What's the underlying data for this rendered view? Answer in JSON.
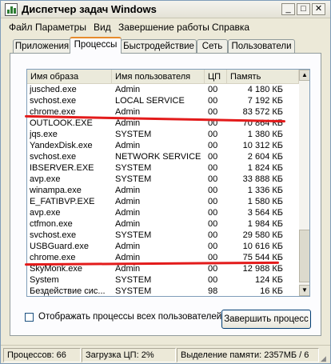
{
  "window": {
    "title": "Диспетчер задач Windows"
  },
  "menu": [
    "Файл",
    "Параметры",
    "Вид",
    "Завершение работы",
    "Справка"
  ],
  "tabs": [
    "Приложения",
    "Процессы",
    "Быстродействие",
    "Сеть",
    "Пользователи"
  ],
  "active_tab": "Процессы",
  "columns": [
    "Имя образа",
    "Имя пользователя",
    "ЦП",
    "Память"
  ],
  "processes": [
    {
      "name": "jusched.exe",
      "user": "Admin",
      "cpu": "00",
      "mem": "4 180 КБ"
    },
    {
      "name": "svchost.exe",
      "user": "LOCAL SERVICE",
      "cpu": "00",
      "mem": "7 192 КБ"
    },
    {
      "name": "chrome.exe",
      "user": "Admin",
      "cpu": "00",
      "mem": "83 572 КБ"
    },
    {
      "name": "OUTLOOK.EXE",
      "user": "Admin",
      "cpu": "00",
      "mem": "70 864 КБ"
    },
    {
      "name": "jqs.exe",
      "user": "SYSTEM",
      "cpu": "00",
      "mem": "1 380 КБ"
    },
    {
      "name": "YandexDisk.exe",
      "user": "Admin",
      "cpu": "00",
      "mem": "10 312 КБ"
    },
    {
      "name": "svchost.exe",
      "user": "NETWORK SERVICE",
      "cpu": "00",
      "mem": "2 604 КБ"
    },
    {
      "name": "IBSERVER.EXE",
      "user": "SYSTEM",
      "cpu": "00",
      "mem": "1 824 КБ"
    },
    {
      "name": "avp.exe",
      "user": "SYSTEM",
      "cpu": "00",
      "mem": "33 888 КБ"
    },
    {
      "name": "winampa.exe",
      "user": "Admin",
      "cpu": "00",
      "mem": "1 336 КБ"
    },
    {
      "name": "E_FATIBVP.EXE",
      "user": "Admin",
      "cpu": "00",
      "mem": "1 580 КБ"
    },
    {
      "name": "avp.exe",
      "user": "Admin",
      "cpu": "00",
      "mem": "3 564 КБ"
    },
    {
      "name": "ctfmon.exe",
      "user": "Admin",
      "cpu": "00",
      "mem": "1 984 КБ"
    },
    {
      "name": "svchost.exe",
      "user": "SYSTEM",
      "cpu": "00",
      "mem": "29 580 КБ"
    },
    {
      "name": "USBGuard.exe",
      "user": "Admin",
      "cpu": "00",
      "mem": "10 616 КБ"
    },
    {
      "name": "chrome.exe",
      "user": "Admin",
      "cpu": "00",
      "mem": "75 544 КБ"
    },
    {
      "name": "SkyMonk.exe",
      "user": "Admin",
      "cpu": "00",
      "mem": "12 988 КБ"
    },
    {
      "name": "System",
      "user": "SYSTEM",
      "cpu": "00",
      "mem": "124 КБ"
    },
    {
      "name": "Бездействие сис...",
      "user": "SYSTEM",
      "cpu": "98",
      "mem": "16 КБ"
    }
  ],
  "checkbox": {
    "label": "Отображать процессы всех пользователей",
    "checked": false
  },
  "end_button": "Завершить процесс",
  "status": {
    "processes": "Процессов: 66",
    "cpu": "Загрузка ЦП: 2%",
    "memory": "Выделение памяти: 2357МБ / 6"
  },
  "icons": [
    "taskmanager-icon",
    "minimize-icon",
    "maximize-icon",
    "close-icon",
    "scroll-up-icon",
    "scroll-down-icon",
    "size-grip-icon"
  ],
  "annotation_color": "#e31b1b"
}
